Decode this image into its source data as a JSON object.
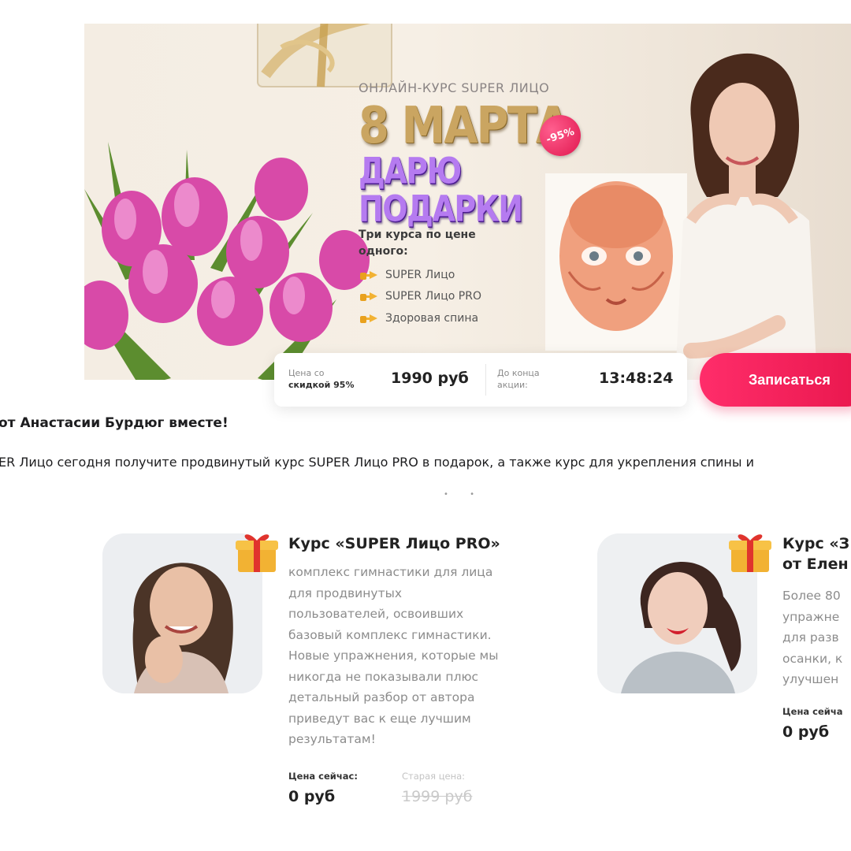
{
  "hero": {
    "kicker": "ОНЛАЙН-КУРС SUPER ЛИЦО",
    "headline_1": "8 МАРТА",
    "headline_2": "ДАРЮ ПОДАРКИ",
    "discount_badge": "-95%",
    "offer_title": "Три курса по цене одного:",
    "offer_items": [
      "SUPER Лицо",
      "SUPER Лицо PRO",
      "Здоровая спина"
    ],
    "price_label_line_1": "Цена со",
    "price_label_line_2": "скидкой 95%",
    "price_value": "1990 руб",
    "timer_label_line_1": "До конца",
    "timer_label_line_2": "акции:",
    "timer_value": "13:48:24",
    "cta_label": "Записаться",
    "accent_color": "#e8164c"
  },
  "intro": {
    "line_1": "от Анастасии Бурдюг вместе!",
    "line_2": "ER Лицо сегодня получите продвинутый курс SUPER Лицо PRO в подарок, а также курс для укрепления спины и"
  },
  "carousel_dots": "• •",
  "cards": [
    {
      "title": "Курс «SUPER Лицо PRO»",
      "desc_lines": [
        "комплекс гимнастики для лица",
        "для продвинутых",
        "пользователей, освоивших",
        "базовый комплекс гимнастики.",
        "Новые упражнения, которые мы",
        "никогда не показывали плюс",
        "детальный разбор от автора",
        "приведут вас к еще лучшим",
        "результатам!"
      ],
      "price_label": "Цена сейчас:",
      "old_price_label": "Старая цена:",
      "price_now": "0 руб",
      "price_old": "1999 руб"
    },
    {
      "title_line_1": "Курс «З",
      "title_line_2": "от Елен",
      "desc_lines": [
        "Более 80",
        "упражне",
        "для разв",
        "осанки, к",
        "улучшен"
      ],
      "price_label": "Цена сейча",
      "price_now": "0 руб"
    }
  ]
}
